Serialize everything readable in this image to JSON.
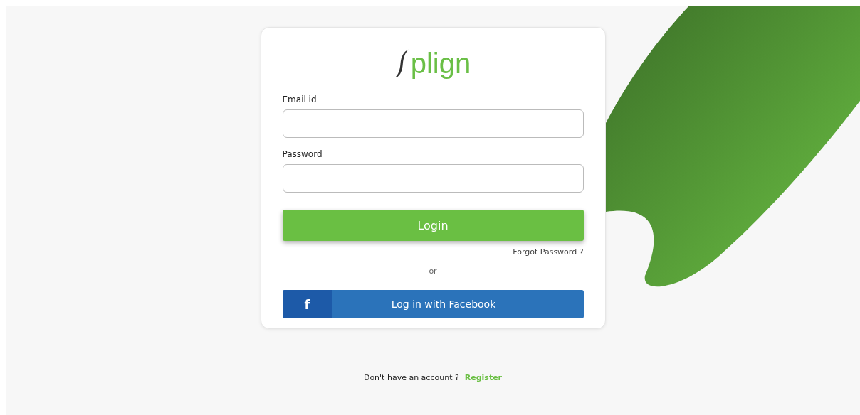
{
  "logo": {
    "text": "plign"
  },
  "fields": [
    {
      "label": "Email id"
    },
    {
      "label": "Password"
    }
  ],
  "login_button": "Login",
  "forgot_link": "Forgot Password ?",
  "divider_text": "or",
  "facebook_button": {
    "icon": "f",
    "label": "Log in with Facebook"
  },
  "footer": {
    "text": "Don't have an account ?",
    "link": "Register"
  }
}
